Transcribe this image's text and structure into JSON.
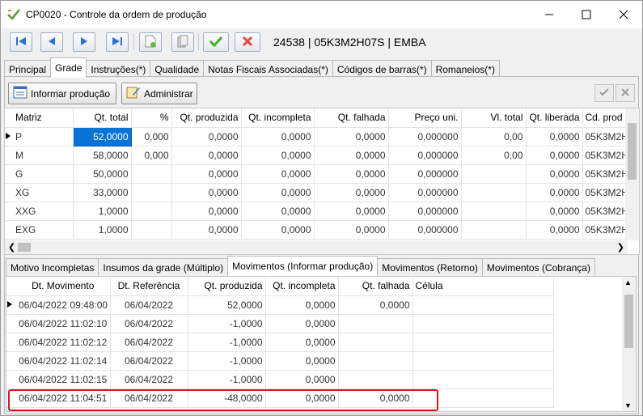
{
  "window": {
    "title": "CP0020 - Controle da ordem de produção",
    "record_label": "24538  |  05K3M2H07S  |  EMBA"
  },
  "toolbar": {
    "buttons": [
      "first-record-icon",
      "previous-record-icon",
      "next-record-icon",
      "last-record-icon",
      "new-record-icon",
      "copy-record-icon",
      "confirm-icon",
      "cancel-icon"
    ]
  },
  "tabs": [
    "Principal",
    "Grade",
    "Instruções(*)",
    "Qualidade",
    "Notas Fiscais Associadas(*)",
    "Códigos de barras(*)",
    "Romaneios(*)"
  ],
  "active_tab": "Grade",
  "actions": {
    "informar_label": "Informar produção",
    "administrar_label": "Administrar"
  },
  "grade_grid": {
    "columns": [
      "Matriz",
      "Qt. total",
      "%",
      "Qt. produzida",
      "Qt. incompleta",
      "Qt. falhada",
      "Preço uni.",
      "Vl. total",
      "Qt. liberada",
      "Cd. prod"
    ],
    "rows": [
      [
        "P",
        "52,0000",
        "0,000",
        "0,0000",
        "0,0000",
        "0,0000",
        "0,000000",
        "0,00",
        "0,0000",
        "05K3M2H"
      ],
      [
        "M",
        "58,0000",
        "0,000",
        "0,0000",
        "0,0000",
        "0,0000",
        "0,000000",
        "0,00",
        "0,0000",
        "05K3M2H"
      ],
      [
        "G",
        "50,0000",
        "",
        "0,0000",
        "0,0000",
        "0,0000",
        "0,000000",
        "",
        "0,0000",
        "05K3M2H"
      ],
      [
        "XG",
        "33,0000",
        "",
        "0,0000",
        "0,0000",
        "0,0000",
        "0,000000",
        "",
        "0,0000",
        "05K3M2H"
      ],
      [
        "XXG",
        "1,0000",
        "",
        "0,0000",
        "0,0000",
        "0,0000",
        "0,000000",
        "",
        "0,0000",
        "05K3M2H"
      ],
      [
        "EXG",
        "1,0000",
        "",
        "0,0000",
        "0,0000",
        "0,0000",
        "0,000000",
        "",
        "0,0000",
        "05K3M2H"
      ]
    ]
  },
  "subtabs": [
    "Motivo Incompletas",
    "Insumos da grade (Múltiplo)",
    "Movimentos (Informar produção)",
    "Movimentos (Retorno)",
    "Movimentos (Cobrança)"
  ],
  "active_subtab": "Movimentos (Informar produção)",
  "mov_grid": {
    "columns": [
      "Dt. Movimento",
      "Dt. Referência",
      "Qt. produzida",
      "Qt. incompleta",
      "Qt. falhada",
      "Célula"
    ],
    "rows": [
      [
        "06/04/2022 09:48:00",
        "06/04/2022",
        "52,0000",
        "0,0000",
        "0,0000",
        ""
      ],
      [
        "06/04/2022 11:02:10",
        "06/04/2022",
        "-1,0000",
        "0,0000",
        "",
        ""
      ],
      [
        "06/04/2022 11:02:12",
        "06/04/2022",
        "-1,0000",
        "0,0000",
        "",
        ""
      ],
      [
        "06/04/2022 11:02:14",
        "06/04/2022",
        "-1,0000",
        "0,0000",
        "",
        ""
      ],
      [
        "06/04/2022 11:02:15",
        "06/04/2022",
        "-1,0000",
        "0,0000",
        "",
        ""
      ],
      [
        "06/04/2022 11:04:51",
        "06/04/2022",
        "-48,0000",
        "0,0000",
        "0,0000",
        ""
      ]
    ]
  },
  "colors": {
    "selection": "#0a74d6",
    "highlight": "#e0141e",
    "confirm_green": "#3fae2a",
    "cancel_red": "#e34a3a",
    "nav_blue": "#2f6fd6"
  }
}
